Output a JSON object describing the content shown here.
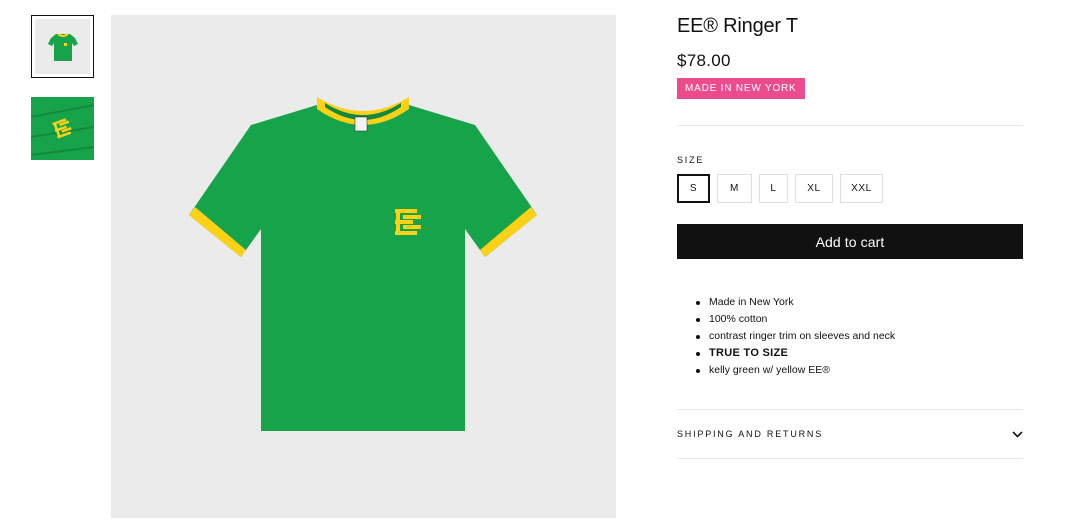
{
  "gallery": {
    "thumbnails": [
      {
        "alt": "green-ringer-tee-front",
        "selected": true
      },
      {
        "alt": "ee-logo-detail",
        "selected": false
      }
    ],
    "main_image": "green-ringer-tee-front",
    "colors": {
      "shirt": "#16a34a",
      "trim": "#fcd116",
      "background": "#ebebeb"
    }
  },
  "product": {
    "title": "EE® Ringer T",
    "price": "$78.00",
    "badge": "MADE IN NEW YORK",
    "badge_color": "#ec4b8e"
  },
  "size_selector": {
    "label": "SIZE",
    "options": [
      "S",
      "M",
      "L",
      "XL",
      "XXL"
    ],
    "selected": "S"
  },
  "cart": {
    "label": "Add to cart"
  },
  "description": [
    "Made in New York",
    "100% cotton",
    "contrast ringer trim on sleeves and neck",
    "TRUE TO SIZE",
    "kelly green w/ yellow EE®"
  ],
  "accordion": {
    "label": "SHIPPING AND RETURNS",
    "icon": "chevron-down-icon"
  }
}
